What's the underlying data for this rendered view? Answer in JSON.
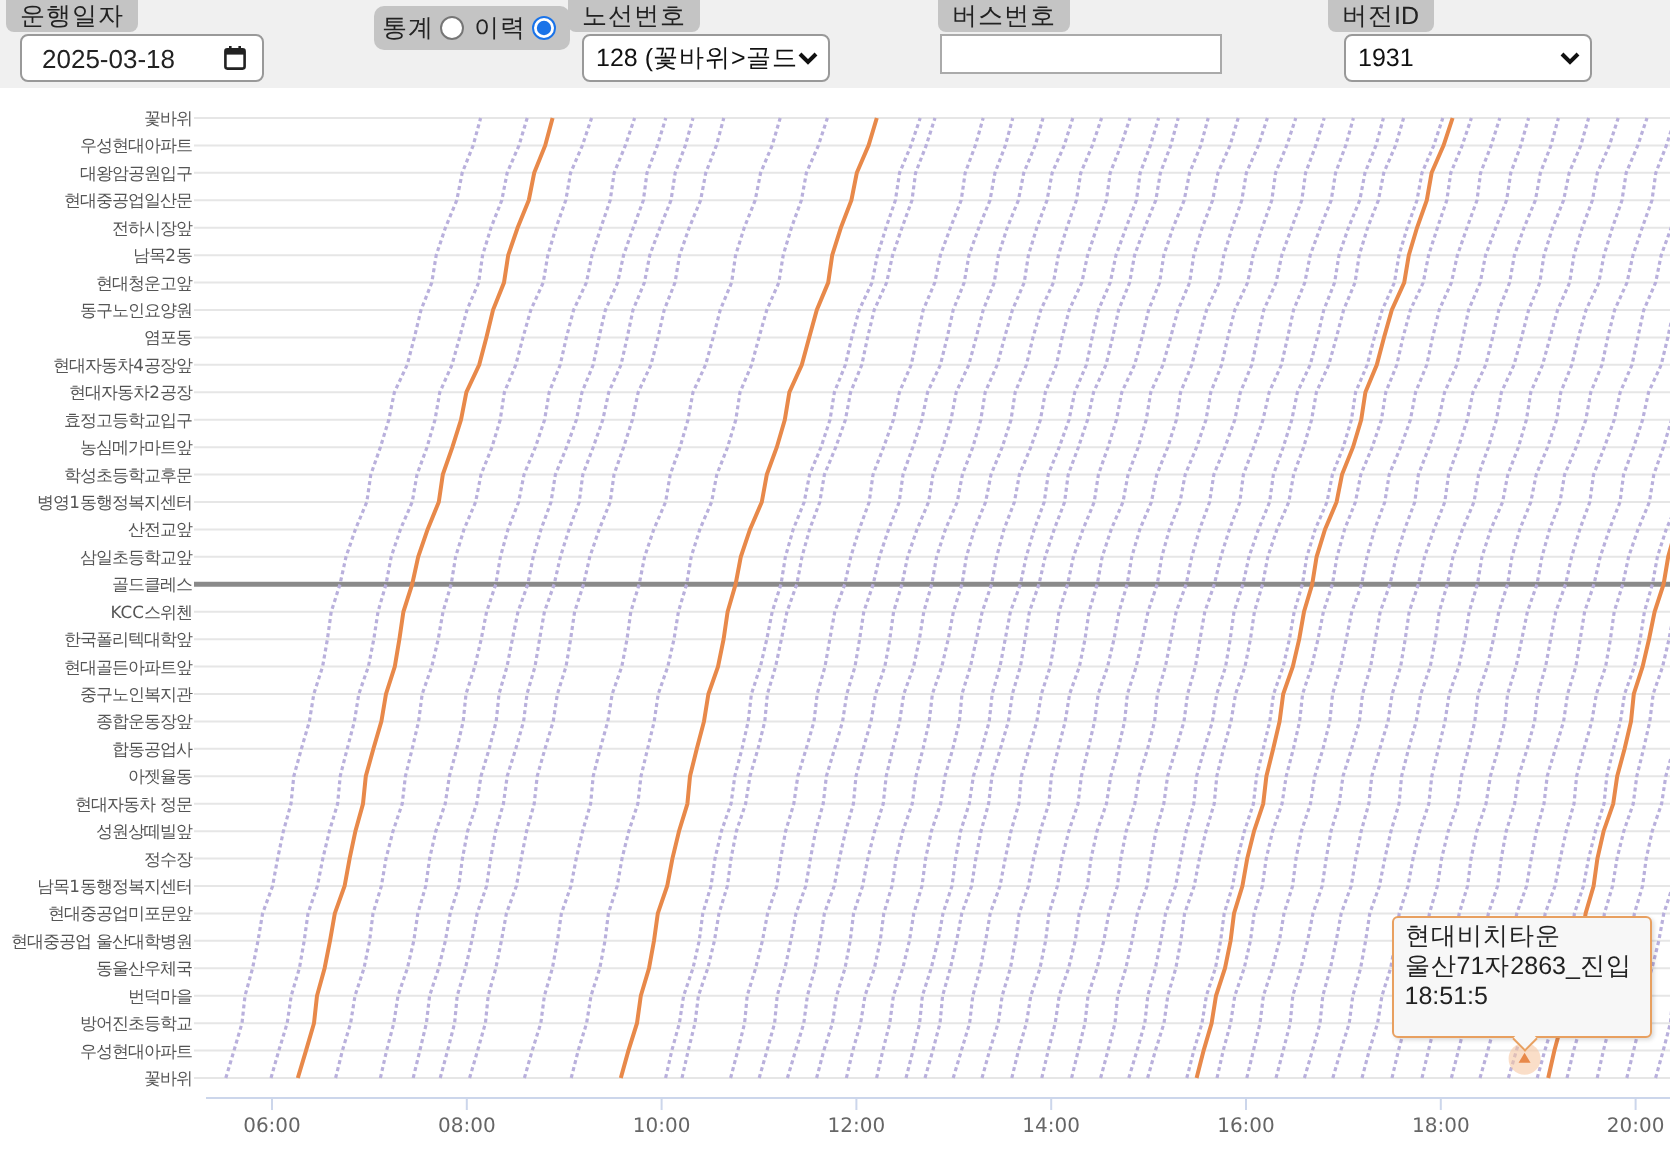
{
  "filters": {
    "date": {
      "label": "운행일자",
      "value": "2025-03-18"
    },
    "mode_options": [
      {
        "label": "통계",
        "selected": false
      },
      {
        "label": "이력",
        "selected": true
      }
    ],
    "route": {
      "label": "노선번호",
      "value": "128 (꽃바위>골드"
    },
    "bus": {
      "label": "버스번호"
    },
    "version": {
      "label": "버전ID",
      "value": "1931"
    }
  },
  "diagram": {
    "stops": [
      "꽃바위",
      "우성현대아파트",
      "대왕암공원입구",
      "현대중공업일산문",
      "전하시장앞",
      "남목2동",
      "현대청운고앞",
      "동구노인요양원",
      "염포동",
      "현대자동차4공장앞",
      "현대자동차2공장",
      "효정고등학교입구",
      "농심메가마트앞",
      "학성초등학교후문",
      "병영1동행정복지센터",
      "산전교앞",
      "삼일초등학교앞",
      "골드클레스",
      "KCC스위첸",
      "한국폴리텍대학앞",
      "현대골든아파트앞",
      "중구노인복지관",
      "종합운동장앞",
      "합동공업사",
      "아젯율동",
      "현대자동차 정문",
      "성원상떼빌앞",
      "정수장",
      "남목1동행정복지센터",
      "현대중공업미포문앞",
      "현대중공업 울산대학병원",
      "동울산우체국",
      "번덕마을",
      "방어진초등학교",
      "우성현대아파트",
      "꽃바위"
    ],
    "time_labels": [
      "06:00",
      "08:00",
      "10:00",
      "12:00",
      "14:00",
      "16:00",
      "18:00",
      "20:00"
    ],
    "tooltip": [
      "현대비치타운",
      "울산71자2863_진입",
      "18:51:5"
    ]
  }
}
